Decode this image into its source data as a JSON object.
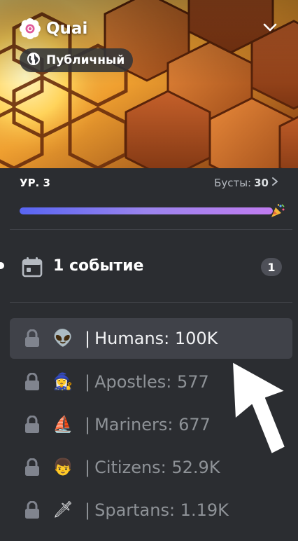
{
  "server": {
    "name": "Quai",
    "visibility_label": "Публичный",
    "icons": {
      "server": "server-verified-flower-icon",
      "visibility": "globe-icon",
      "menu": "chevron-down-icon"
    }
  },
  "boost": {
    "level_label": "УР. 3",
    "boosts_label": "Бусты:",
    "boosts_count": "30",
    "progress": 1.0,
    "progress_icon": "party-popper-icon"
  },
  "events": {
    "label": "1 событие",
    "count": "1",
    "icon": "calendar-icon"
  },
  "channels": [
    {
      "emoji": "👽",
      "bar": "|",
      "name": "Humans: 100K",
      "active": true,
      "icon": "lock-icon"
    },
    {
      "emoji": "🧙‍♀️",
      "bar": "|",
      "name": "Apostles: 577",
      "active": false,
      "icon": "lock-icon"
    },
    {
      "emoji": "⛵",
      "bar": "|",
      "name": "Mariners: 677",
      "active": false,
      "icon": "lock-icon"
    },
    {
      "emoji": "👦",
      "bar": "|",
      "name": "Citizens: 52.9K",
      "active": false,
      "icon": "lock-icon"
    },
    {
      "emoji": "🗡",
      "bar": "|",
      "name": "Spartans: 1.19K",
      "active": false,
      "icon": "lock-icon"
    }
  ],
  "colors": {
    "background": "#2b2d31",
    "active_row": "#404249",
    "muted_text": "#8e9297",
    "progress_start": "#5865f2",
    "progress_end": "#c07cf0"
  }
}
